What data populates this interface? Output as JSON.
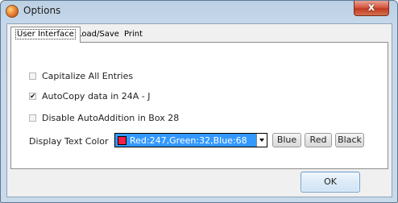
{
  "window": {
    "title": "Options",
    "close_glyph": "x"
  },
  "tabs": [
    {
      "label": "User Interface",
      "active": true
    },
    {
      "label": "Load/Save",
      "active": false
    },
    {
      "label": "Print",
      "active": false
    }
  ],
  "options": {
    "capitalize": {
      "label": "Capitalize All Entries",
      "checked": false
    },
    "autocopy": {
      "label": "AutoCopy data in 24A - J",
      "checked": true,
      "mark": "✔"
    },
    "disable_autoaddition": {
      "label": "Disable AutoAddition in Box 28",
      "checked": false
    }
  },
  "display_color": {
    "label": "Display Text Color",
    "selected_text": "Red:247,Green:32,Blue:68",
    "swatch_color": "#f72044",
    "buttons": {
      "blue": "Blue",
      "red": "Red",
      "black": "Black"
    }
  },
  "footer": {
    "ok_label": "OK"
  },
  "icons": {
    "app": "options-app-icon",
    "close": "close-icon",
    "dropdown": "chevron-down-icon"
  }
}
